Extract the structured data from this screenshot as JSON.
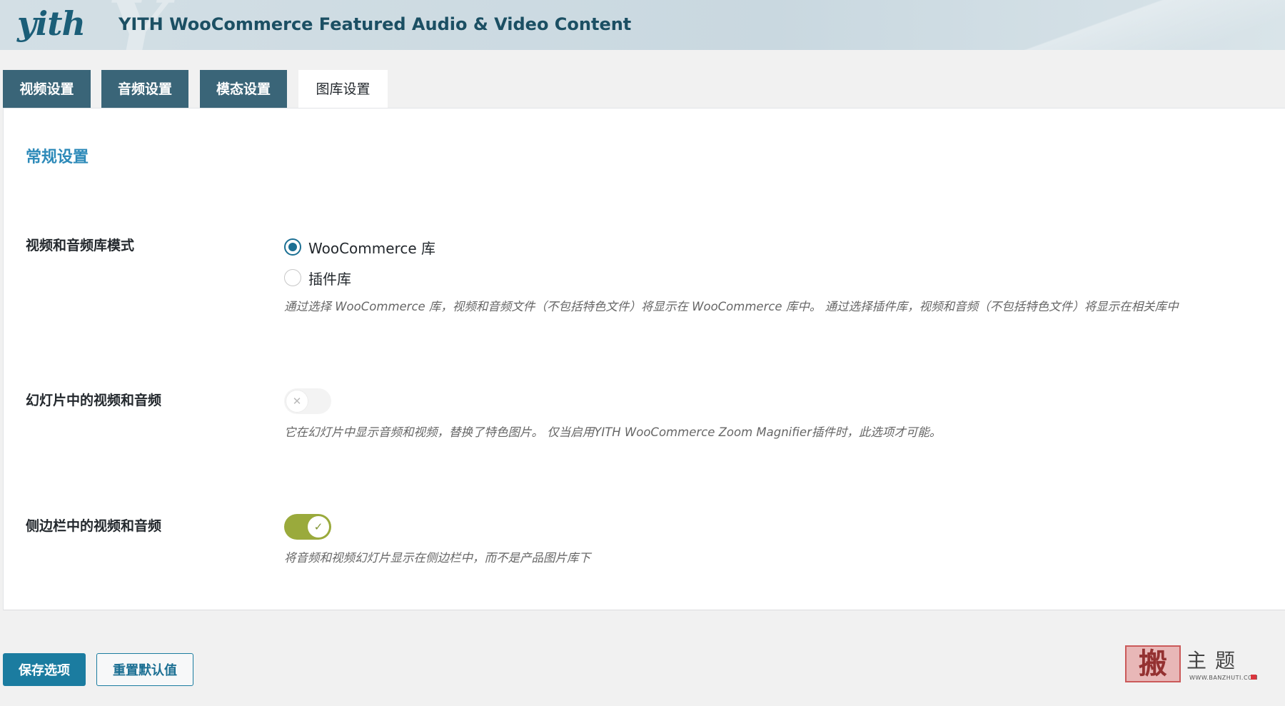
{
  "header": {
    "logo_text": "yith",
    "plugin_title": "YITH WooCommerce Featured Audio & Video Content"
  },
  "tabs": [
    {
      "label": "视频设置",
      "active": false
    },
    {
      "label": "音频设置",
      "active": false
    },
    {
      "label": "模态设置",
      "active": false
    },
    {
      "label": "图库设置",
      "active": true
    }
  ],
  "section": {
    "title": "常规设置"
  },
  "settings": {
    "gallery_mode": {
      "label": "视频和音频库模式",
      "options": [
        {
          "label": "WooCommerce 库",
          "checked": true
        },
        {
          "label": "插件库",
          "checked": false
        }
      ],
      "description": "通过选择 WooCommerce 库，视频和音频文件（不包括特色文件）将显示在 WooCommerce 库中。 通过选择插件库，视频和音频（不包括特色文件）将显示在相关库中"
    },
    "slider_media": {
      "label": "幻灯片中的视频和音频",
      "enabled": false,
      "description": "它在幻灯片中显示音频和视频，替换了特色图片。 仅当启用YITH WooCommerce Zoom Magnifier插件时，此选项才可能。"
    },
    "sidebar_media": {
      "label": "侧边栏中的视频和音频",
      "enabled": true,
      "description": "将音频和视频幻灯片显示在侧边栏中，而不是产品图片库下"
    }
  },
  "footer": {
    "save_label": "保存选项",
    "reset_label": "重置默认值"
  },
  "watermark": {
    "seal_text": "搬",
    "title": "主题",
    "url": "WWW.BANZHUTI.COM"
  },
  "colors": {
    "tab_inactive": "#3a6578",
    "accent": "#2d8ab9",
    "toggle_on": "#9aaa3c",
    "save_button": "#1b7ca0"
  }
}
